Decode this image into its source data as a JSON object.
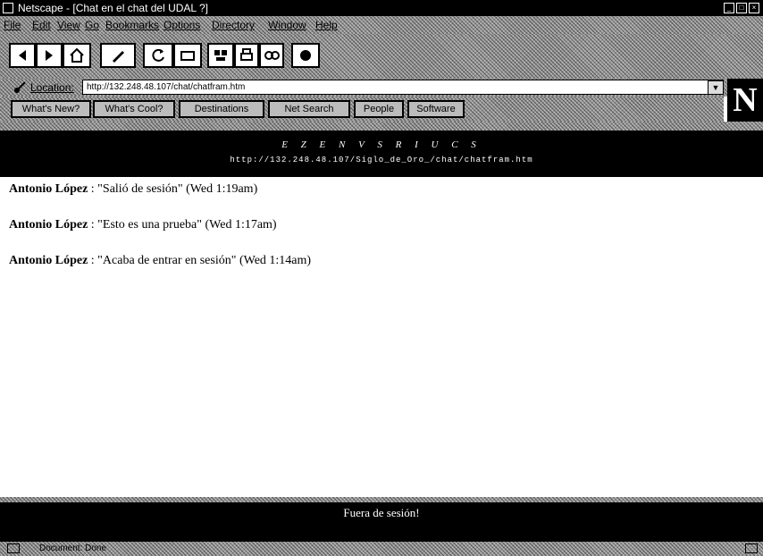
{
  "window": {
    "title": "Netscape - [Chat en el chat del UDAL ?]"
  },
  "menu": [
    "File",
    "Edit",
    "View",
    "Go",
    "Bookmarks",
    "Options",
    "Directory",
    "Window",
    "Help"
  ],
  "toolbar": {
    "buttons": [
      {
        "icon": "back-icon"
      },
      {
        "icon": "forward-icon"
      },
      {
        "icon": "home-icon"
      },
      {
        "icon": "edit-icon"
      },
      {
        "icon": "reload-icon"
      },
      {
        "icon": "images-icon"
      },
      {
        "icon": "open-icon"
      },
      {
        "icon": "print-icon"
      },
      {
        "icon": "find-icon"
      },
      {
        "icon": "stop-icon"
      }
    ]
  },
  "location": {
    "label": "Location:",
    "url": "http://132.248.48.107/chat/chatfram.htm"
  },
  "directory_buttons": [
    "What's New?",
    "What's Cool?",
    "Destinations",
    "Net Search",
    "People",
    "Software"
  ],
  "logo": {
    "letter": "N"
  },
  "header": {
    "title": "E Z E N V S R I U C S",
    "url": "http://132.248.48.107/Siglo_de_Oro_/chat/chatfram.htm"
  },
  "messages": [
    {
      "user": "Antonio López",
      "text": " : \"Salió de sesión\" (Wed 1:19am)"
    },
    {
      "user": "Antonio López",
      "text": " : \"Esto es una prueba\" (Wed 1:17am)"
    },
    {
      "user": "Antonio López",
      "text": " : \"Acaba de entrar en sesión\" (Wed 1:14am)"
    }
  ],
  "footer": {
    "logout_label": "Fuera de sesión!"
  },
  "status": {
    "text": "Document: Done"
  }
}
